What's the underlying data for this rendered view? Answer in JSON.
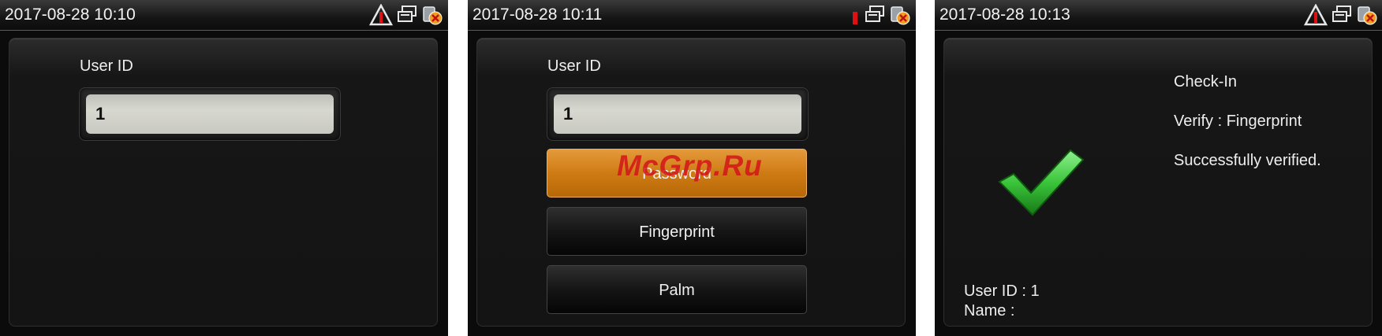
{
  "screens": [
    {
      "status": {
        "time": "2017-08-28 10:10",
        "icons": [
          "warning-alert-icon",
          "network-icon",
          "usb-disconnected-icon"
        ]
      },
      "user_id_label": "User ID",
      "user_id_value": "1"
    },
    {
      "status": {
        "time": "2017-08-28 10:11",
        "icons": [
          "alert-exclamation-icon",
          "network-icon",
          "usb-disconnected-icon"
        ]
      },
      "user_id_label": "User ID",
      "user_id_value": "1",
      "verify_options": [
        "Password",
        "Fingerprint",
        "Palm"
      ],
      "selected_option": "Password",
      "watermark": "McGrp.Ru"
    },
    {
      "status": {
        "time": "2017-08-28 10:13",
        "icons": [
          "warning-alert-icon",
          "network-icon",
          "usb-disconnected-icon"
        ]
      },
      "result": {
        "state": "Check-In",
        "verify": "Verify : Fingerprint",
        "message": "Successfully verified."
      },
      "user_id_line": "User ID : 1",
      "name_line": "Name :"
    }
  ],
  "colors": {
    "background": "#0b0b0b",
    "accent_orange": "#cf7b14",
    "input_bg": "#d0d1c9",
    "check_green": "#3bc43b",
    "alert_red": "#e01010"
  }
}
